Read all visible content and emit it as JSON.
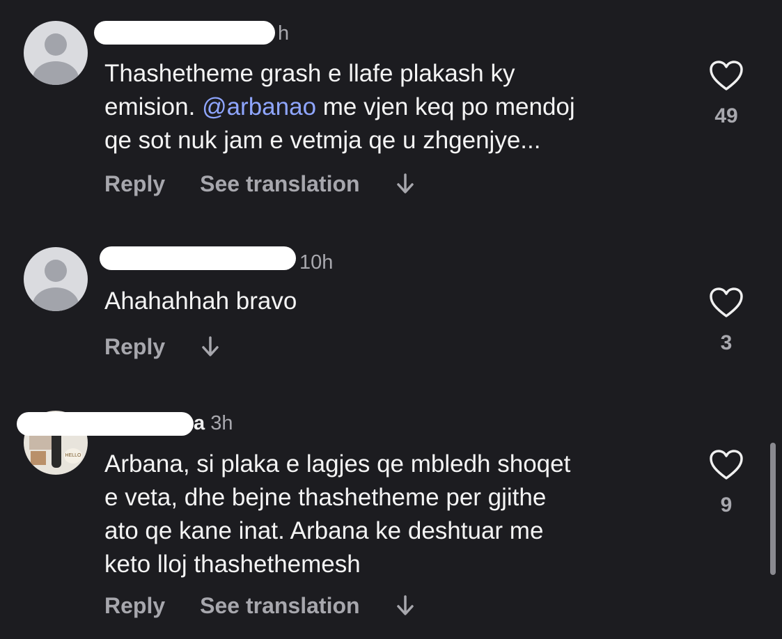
{
  "comments": [
    {
      "time": "h",
      "text_lines": [
        {
          "before": "Thashetheme grash e llafe plakash ky",
          "mention": "",
          "after": ""
        },
        {
          "before": "emision. ",
          "mention": "@arbanao",
          "after": " me vjen keq po mendoj"
        },
        {
          "before": "qe sot nuk jam e vetmja qe u zhgenjye...",
          "mention": "",
          "after": ""
        }
      ],
      "reply_label": "Reply",
      "translate_label": "See translation",
      "like_count": "49"
    },
    {
      "time": "10h",
      "text_lines": [
        {
          "before": "Ahahahhah bravo",
          "mention": "",
          "after": ""
        }
      ],
      "reply_label": "Reply",
      "like_count": "3"
    },
    {
      "name_tail": "a",
      "time": "3h",
      "avatar_text": "HELLO",
      "text_lines": [
        {
          "before": "Arbana, si plaka e lagjes qe mbledh shoqet",
          "mention": "",
          "after": ""
        },
        {
          "before": "e veta, dhe bejne thashetheme per gjithe",
          "mention": "",
          "after": ""
        },
        {
          "before": "ato qe kane inat. Arbana ke deshtuar me",
          "mention": "",
          "after": ""
        },
        {
          "before": "keto lloj thashethemesh",
          "mention": "",
          "after": ""
        }
      ],
      "reply_label": "Reply",
      "translate_label": "See translation",
      "like_count": "9"
    }
  ],
  "icons": {
    "heart": "heart-outline-icon",
    "arrow": "arrow-down-icon",
    "avatar": "default-avatar-icon"
  },
  "colors": {
    "background": "#1c1c20",
    "text": "#f4f4f4",
    "muted": "#a7a7ad",
    "mention": "#8fa6ff"
  }
}
